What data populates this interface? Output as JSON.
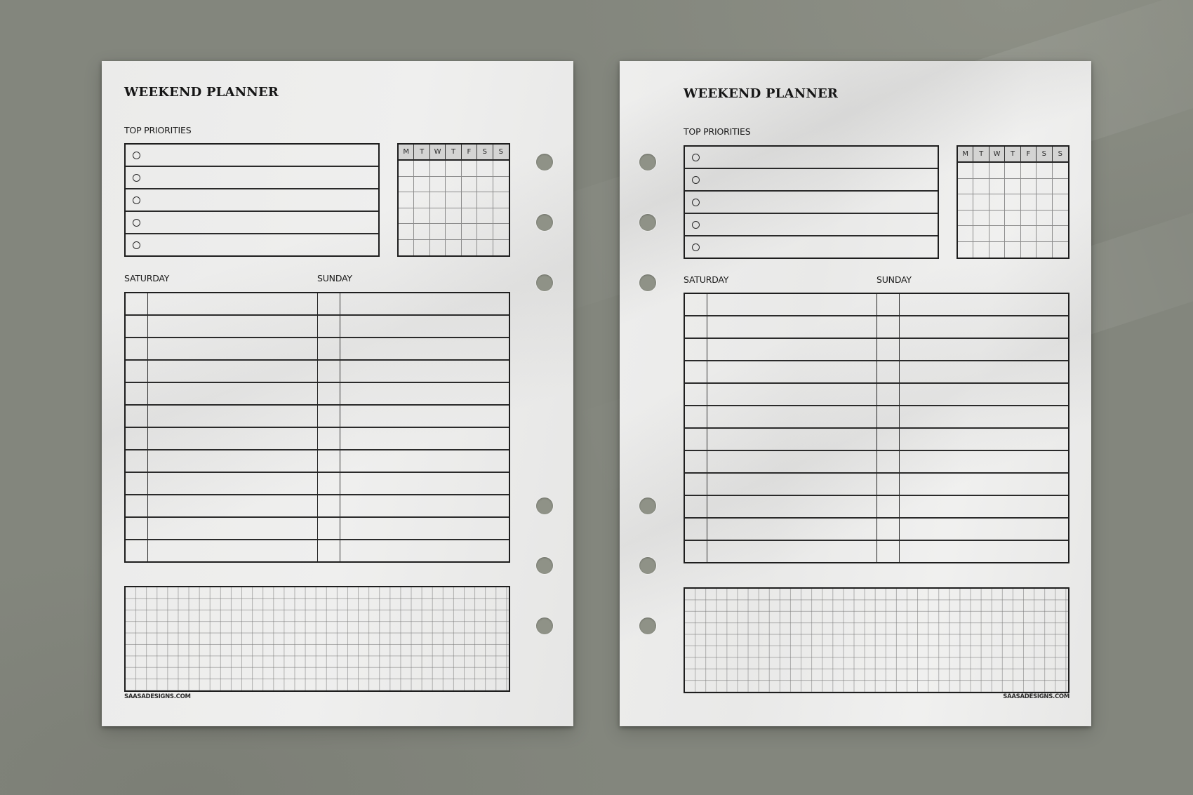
{
  "scene": {
    "background_color": "#83867d",
    "paper_color": "#ececeb",
    "ink_color": "#1e1e1e"
  },
  "pages": [
    {
      "side": "left",
      "title": "WEEKEND PLANNER",
      "priorities_label": "TOP PRIORITIES",
      "priorities_count": 5,
      "calendar_days": [
        "M",
        "T",
        "W",
        "T",
        "F",
        "S",
        "S"
      ],
      "calendar_rows": 6,
      "saturday_label": "SATURDAY",
      "sunday_label": "SUNDAY",
      "schedule_rows": 12,
      "footer": "SAASADESIGNS.COM",
      "binder_holes_side": "right",
      "binder_holes": 6
    },
    {
      "side": "right",
      "title": "WEEKEND PLANNER",
      "priorities_label": "TOP PRIORITIES",
      "priorities_count": 5,
      "calendar_days": [
        "M",
        "T",
        "W",
        "T",
        "F",
        "S",
        "S"
      ],
      "calendar_rows": 6,
      "saturday_label": "SATURDAY",
      "sunday_label": "SUNDAY",
      "schedule_rows": 12,
      "footer": "SAASADESIGNS.COM",
      "binder_holes_side": "left",
      "binder_holes": 6
    }
  ]
}
